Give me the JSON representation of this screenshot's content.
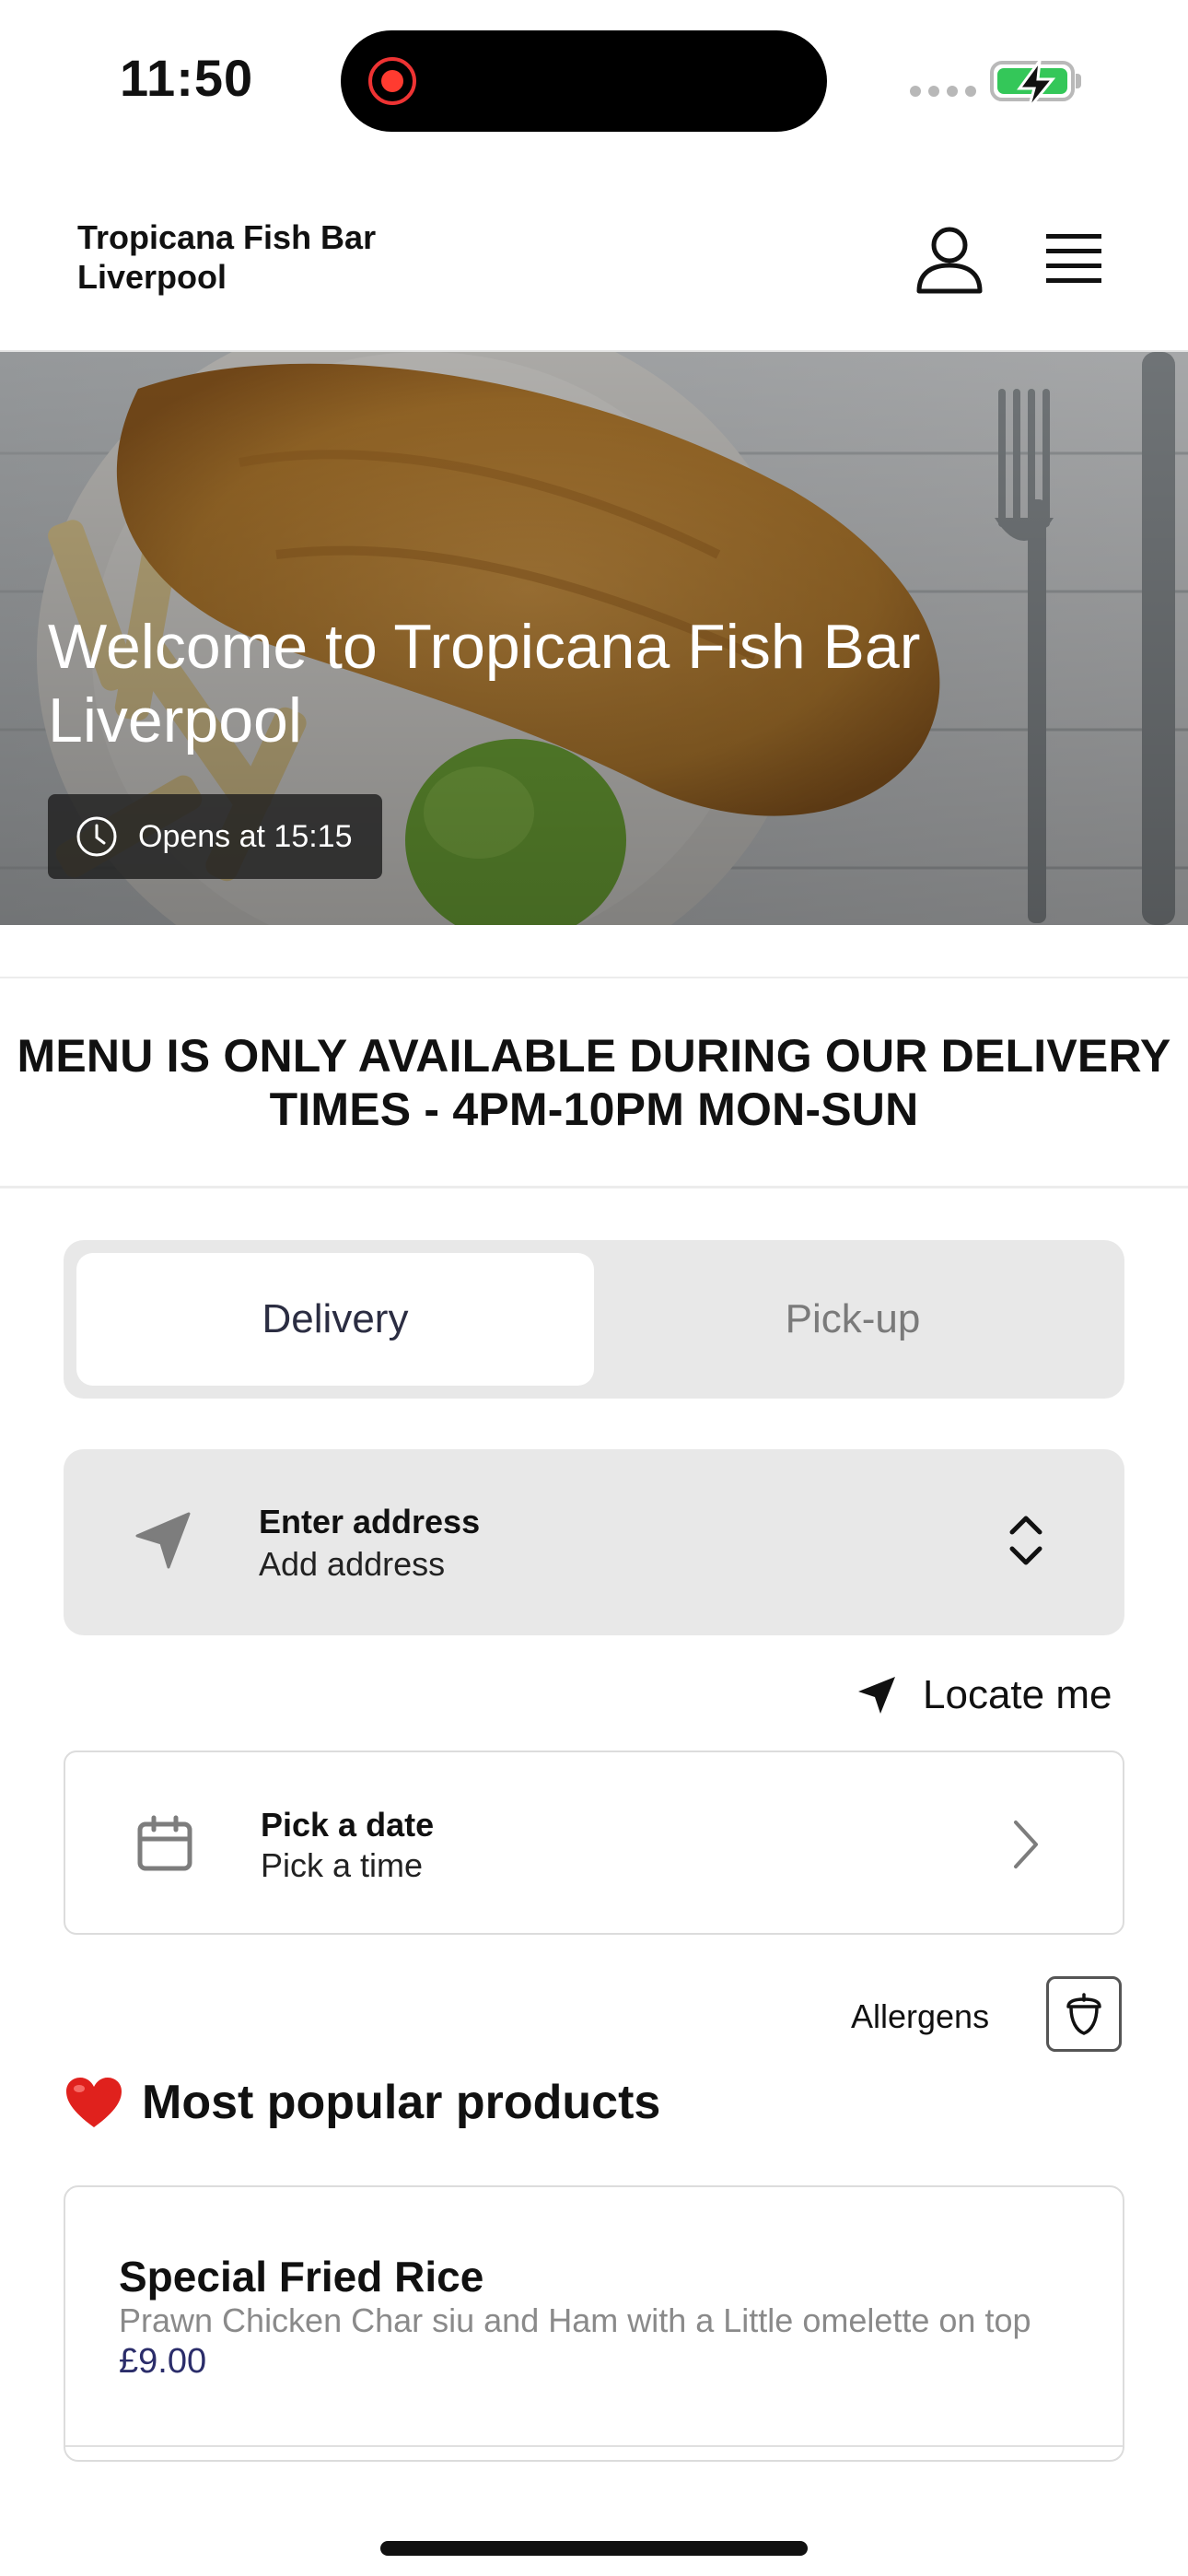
{
  "status_bar": {
    "time": "11:50"
  },
  "header": {
    "title": "Tropicana Fish Bar Liverpool"
  },
  "hero": {
    "title": "Welcome to Tropicana Fish Bar Liverpool",
    "hours_badge": "Opens at 15:15"
  },
  "notice": {
    "text": "MENU IS ONLY AVAILABLE DURING OUR DELIVERY TIMES - 4PM-10PM MON-SUN"
  },
  "order_mode": {
    "options": [
      "Delivery",
      "Pick-up"
    ],
    "selected": "Delivery"
  },
  "address": {
    "title": "Enter address",
    "subtitle": "Add address"
  },
  "locate": {
    "label": "Locate me"
  },
  "schedule": {
    "title": "Pick a date",
    "subtitle": "Pick a time"
  },
  "allergens": {
    "label": "Allergens"
  },
  "popular": {
    "title": "Most popular products",
    "emoji": "❤️",
    "products": [
      {
        "name": "Special Fried Rice",
        "description": "Prawn Chicken Char siu and Ham with a Little omelette on top",
        "price": "£9.00"
      }
    ]
  },
  "colors": {
    "accent_text": "#2b2d42",
    "price": "#2b2d6a",
    "battery": "#34c759",
    "recording": "#ff3b30"
  }
}
